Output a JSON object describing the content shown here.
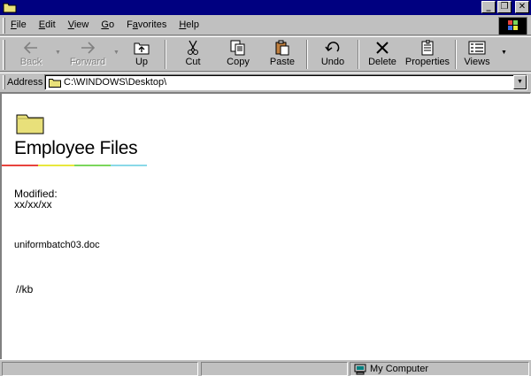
{
  "window": {
    "title": ""
  },
  "menu": {
    "items": [
      {
        "label": "File",
        "key": "F",
        "rest": "ile"
      },
      {
        "label": "Edit",
        "key": "E",
        "rest": "dit"
      },
      {
        "label": "View",
        "key": "V",
        "rest": "iew"
      },
      {
        "label": "Go",
        "key": "G",
        "rest": "o"
      },
      {
        "label": "Favorites",
        "key": "a",
        "pre": "F",
        "rest": "vorites"
      },
      {
        "label": "Help",
        "key": "H",
        "rest": "elp"
      }
    ]
  },
  "toolbar": {
    "back": "Back",
    "forward": "Forward",
    "up": "Up",
    "cut": "Cut",
    "copy": "Copy",
    "paste": "Paste",
    "undo": "Undo",
    "delete": "Delete",
    "properties": "Properties",
    "views": "Views"
  },
  "address": {
    "label": "Address",
    "value": "C:\\WINDOWS\\Desktop\\"
  },
  "content": {
    "folder_title": "Employee Files",
    "modified_label": "Modified:",
    "modified_value": "xx/xx/xx",
    "file_name": "uniformbatch03.doc",
    "initials": "//kb",
    "rainbow_colors": [
      "#e8433d",
      "#e8e83d",
      "#7bd65c",
      "#8ad9e8"
    ]
  },
  "status": {
    "zone": "My Computer"
  },
  "colors": {
    "titlebar": "#000080",
    "face": "#c0c0c0",
    "folder": "#e8e07a"
  }
}
